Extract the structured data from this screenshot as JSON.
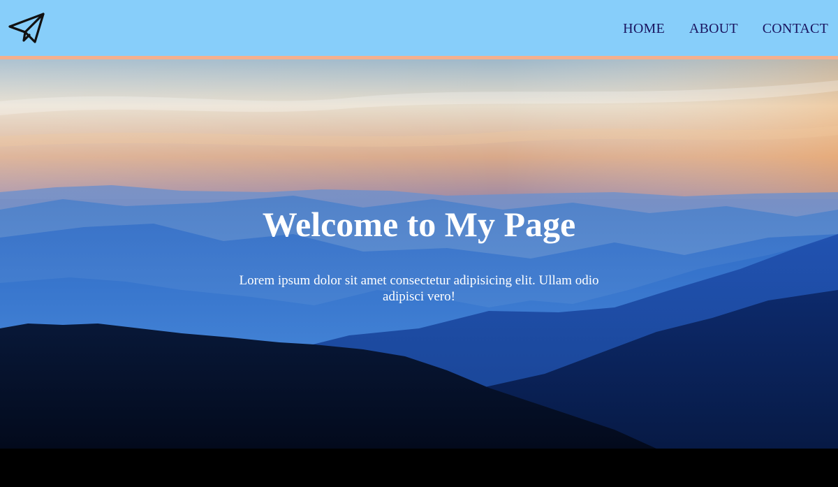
{
  "header": {
    "logo_icon": "paper-plane-icon",
    "background_color": "#87cefa",
    "border_color": "#f4b08e"
  },
  "nav": {
    "items": [
      {
        "label": "HOME"
      },
      {
        "label": "ABOUT"
      },
      {
        "label": "CONTACT"
      }
    ],
    "link_color": "#1a1560"
  },
  "hero": {
    "title": "Welcome to My Page",
    "text": "Lorem ipsum dolor sit amet consectetur adipisicing elit. Ullam odio adipisci vero!"
  }
}
